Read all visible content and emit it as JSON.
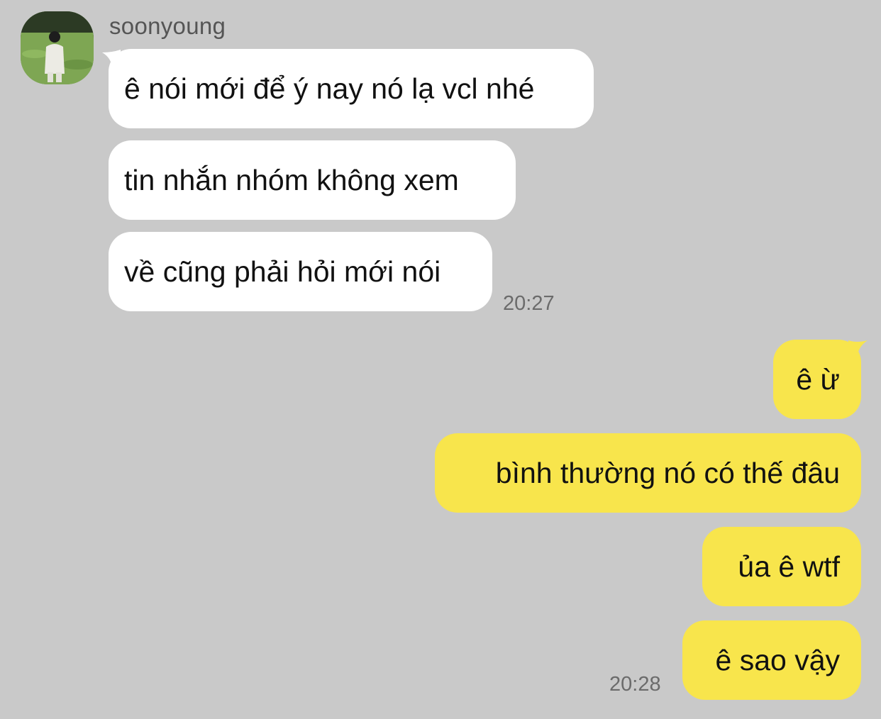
{
  "conversation": {
    "sender_name": "soonyoung",
    "incoming": [
      {
        "text": "ê nói mới để ý nay nó lạ vcl nhé"
      },
      {
        "text": "tin nhắn nhóm không xem"
      },
      {
        "text": "về cũng phải hỏi mới nói"
      }
    ],
    "incoming_time": "20:27",
    "outgoing": [
      {
        "text": "ê ừ"
      },
      {
        "text": "bình thường nó có thế đâu"
      },
      {
        "text": "ủa ê wtf"
      },
      {
        "text": "ê sao vậy"
      }
    ],
    "outgoing_time": "20:28"
  },
  "colors": {
    "background": "#c9c9c9",
    "incoming_bubble": "#ffffff",
    "outgoing_bubble": "#f8e54c"
  }
}
